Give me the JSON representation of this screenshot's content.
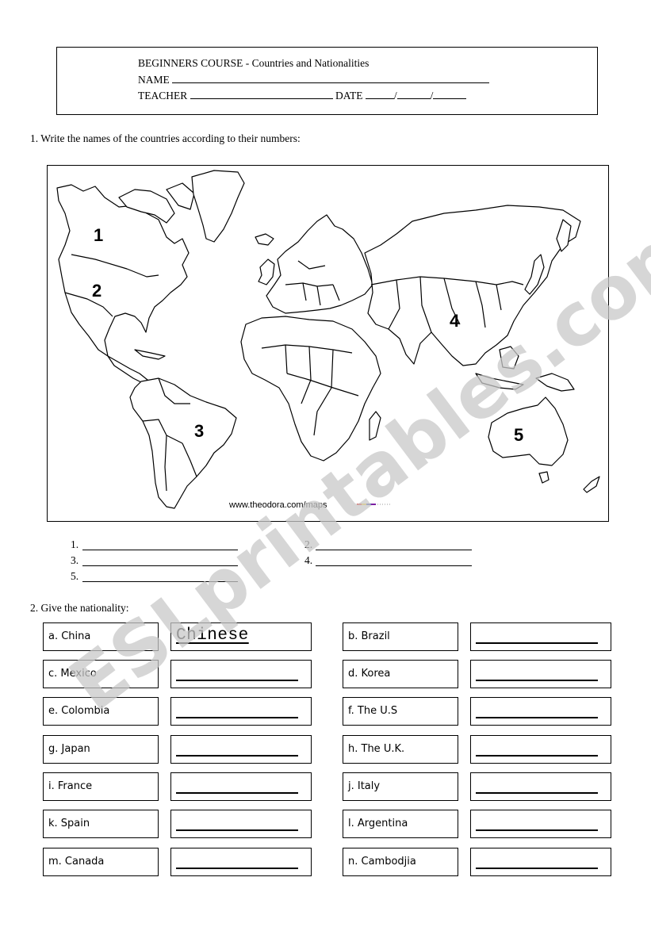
{
  "header": {
    "course_title": "BEGINNERS COURSE - Countries and Nationalities",
    "name_label": "NAME",
    "teacher_label": "TEACHER",
    "date_label": "DATE",
    "date_separator": "/"
  },
  "section1": {
    "instruction": "1. Write the names of the countries according to their numbers:",
    "map": {
      "region_numbers": [
        "1",
        "2",
        "3",
        "4",
        "5"
      ],
      "credit": "www.theodora.com/maps",
      "legend_colors": [
        "#e53935",
        "#fdd835",
        "#3949ab",
        "#7b1fa2"
      ]
    },
    "answers": [
      {
        "label": "1."
      },
      {
        "label": "2."
      },
      {
        "label": "3."
      },
      {
        "label": "4."
      },
      {
        "label": "5."
      }
    ]
  },
  "section2": {
    "instruction": "2. Give the nationality:",
    "items": [
      {
        "country": "a. China",
        "answer": "Chinese"
      },
      {
        "country": "b. Brazil",
        "answer": ""
      },
      {
        "country": "c. Mexico",
        "answer": ""
      },
      {
        "country": "d. Korea",
        "answer": ""
      },
      {
        "country": "e. Colombia",
        "answer": ""
      },
      {
        "country": "f.  The U.S",
        "answer": ""
      },
      {
        "country": "g. Japan",
        "answer": ""
      },
      {
        "country": "h. The U.K.",
        "answer": ""
      },
      {
        "country": "i. France",
        "answer": ""
      },
      {
        "country": "j. Italy",
        "answer": ""
      },
      {
        "country": "k. Spain",
        "answer": ""
      },
      {
        "country": "l. Argentina",
        "answer": ""
      },
      {
        "country": "m. Canada",
        "answer": ""
      },
      {
        "country": "n. Cambodjia",
        "answer": ""
      }
    ]
  },
  "watermark": {
    "text": "ESLprintables.com",
    "color": "#c8c8c8"
  }
}
